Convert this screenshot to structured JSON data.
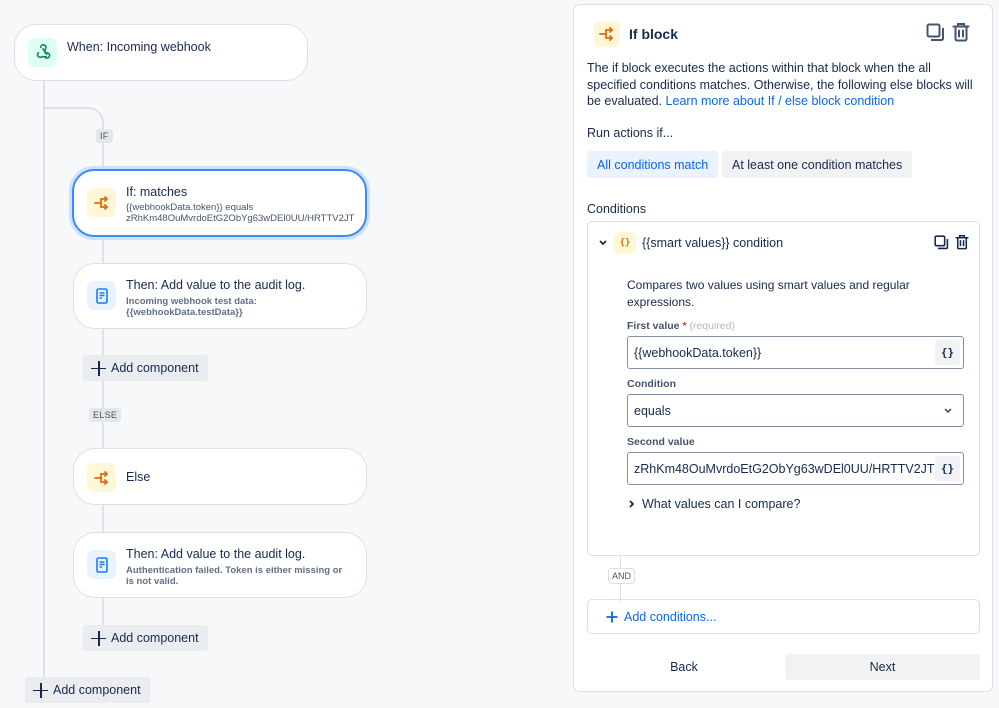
{
  "canvas": {
    "trigger": {
      "title": "When: Incoming webhook",
      "icon": "webhook-icon"
    },
    "if_tag": "IF",
    "else_tag": "ELSE",
    "if_block": {
      "title": "If: matches",
      "subtitle_line1": "{{webhookData.token}} equals",
      "subtitle_line2": "zRhKm48OuMvrdoEtG2ObYg63wDEl0UU/HRTTV2JT",
      "icon": "branch-icon"
    },
    "if_action": {
      "title": "Then: Add value to the audit log.",
      "subtitle_line1": "Incoming webhook test data:",
      "subtitle_line2": "{{webhookData.testData}}",
      "icon": "audit-log-icon"
    },
    "else_block": {
      "title": "Else",
      "icon": "branch-icon"
    },
    "else_action": {
      "title": "Then: Add value to the audit log.",
      "subtitle_line1": "Authentication failed. Token is either missing or",
      "subtitle_line2": "is not valid.",
      "icon": "audit-log-icon"
    },
    "add_component_label": "Add component"
  },
  "panel": {
    "title": "If block",
    "description": "The if block executes the actions within that block when the all specified conditions matches. Otherwise, the following else blocks will be evaluated.",
    "learn_more_link": "Learn more about If / else block condition",
    "run_actions_label": "Run actions if...",
    "match_options": [
      {
        "label": "All conditions match",
        "selected": true
      },
      {
        "label": "At least one condition matches",
        "selected": false
      }
    ],
    "conditions_label": "Conditions",
    "condition": {
      "title": "{{smart values}} condition",
      "icon_glyph": "{}",
      "description": "Compares two values using smart values and regular expressions.",
      "first_value_label": "First value",
      "required_marker": "*",
      "required_hint": "(required)",
      "first_value": "{{webhookData.token}}",
      "condition_label": "Condition",
      "condition_value": "equals",
      "second_value_label": "Second value",
      "second_value": "zRhKm48OuMvrdoEtG2ObYg63wDEl0UU/HRTTV2JT",
      "smart_button_glyph": "{}",
      "help_toggle": "What values can I compare?"
    },
    "and_tag": "AND",
    "add_conditions_label": "Add conditions...",
    "back_label": "Back",
    "next_label": "Next"
  },
  "colors": {
    "accent": "#0c66e4",
    "selected_border": "#388bff",
    "branch_icon": "#e56910",
    "webhook_icon": "#1f845a",
    "log_icon": "#1d7afc",
    "required": "#c9372c"
  }
}
